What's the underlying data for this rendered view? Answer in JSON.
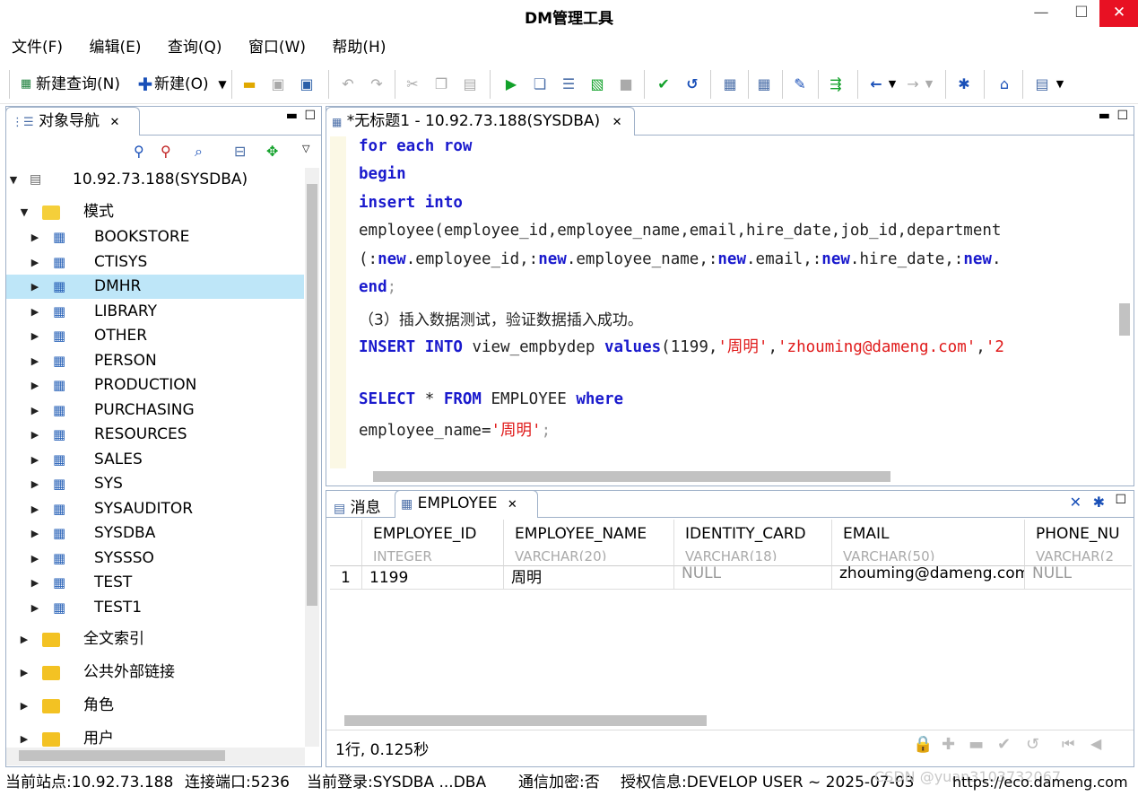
{
  "window": {
    "title": "DM管理工具",
    "minimize": "—",
    "maximize": "☐",
    "close": "✕"
  },
  "menu": [
    "文件(F)",
    "编辑(E)",
    "查询(Q)",
    "窗口(W)",
    "帮助(H)"
  ],
  "toolbar": {
    "new_query": "新建查询(N)",
    "new": "新建(O)"
  },
  "navigator": {
    "tab_label": "对象导航",
    "connection": "10.92.73.188(SYSDBA)",
    "schema_folder": "模式",
    "schemas": [
      "BOOKSTORE",
      "CTISYS",
      "DMHR",
      "LIBRARY",
      "OTHER",
      "PERSON",
      "PRODUCTION",
      "PURCHASING",
      "RESOURCES",
      "SALES",
      "SYS",
      "SYSAUDITOR",
      "SYSDBA",
      "SYSSSO",
      "TEST",
      "TEST1"
    ],
    "selected_schema": "DMHR",
    "folders": [
      "全文索引",
      "公共外部链接",
      "角色",
      "用户"
    ]
  },
  "editor": {
    "tab_label": "*无标题1 - 10.92.73.188(SYSDBA)",
    "lines": {
      "l1": "for each row",
      "l2": "begin",
      "l3": "insert into",
      "l4": "employee(employee_id,employee_name,email,hire_date,job_id,department",
      "l5a": "(:",
      "l5b": "new",
      "l5c": ".employee_id,:",
      "l5d": "new",
      "l5e": ".employee_name,:",
      "l5f": "new",
      "l5g": ".email,:",
      "l5h": "new",
      "l5i": ".hire_date,:",
      "l5j": "new",
      "l5k": ".",
      "l6": "end",
      "l6b": ";",
      "l7": "（3）插入数据测试，验证数据插入成功。",
      "l8a": "INSERT INTO",
      "l8b": " view_empbydep ",
      "l8c": "values",
      "l8d": "(1199,",
      "l8e": "'周明'",
      "l8f": ",",
      "l8g": "'zhouming@dameng.com'",
      "l8h": ",",
      "l8i": "'2",
      "l10a": "SELECT",
      "l10b": " * ",
      "l10c": "FROM",
      "l10d": " EMPLOYEE ",
      "l10e": "where",
      "l11a": "employee_name=",
      "l11b": "'周明'",
      "l11c": ";"
    }
  },
  "results": {
    "tab_messages": "消息",
    "tab_table": "EMPLOYEE",
    "columns": [
      {
        "name": "EMPLOYEE_ID",
        "type": "INTEGER"
      },
      {
        "name": "EMPLOYEE_NAME",
        "type": "VARCHAR(20)"
      },
      {
        "name": "IDENTITY_CARD",
        "type": "VARCHAR(18)"
      },
      {
        "name": "EMAIL",
        "type": "VARCHAR(50)"
      },
      {
        "name": "PHONE_NU",
        "type": "VARCHAR(2"
      }
    ],
    "rows": [
      {
        "num": "1",
        "c1": "1199",
        "c2": "周明",
        "c3": "NULL",
        "c4": "zhouming@dameng.com",
        "c5": "NULL"
      }
    ],
    "summary": "1行, 0.125秒"
  },
  "status": {
    "site": "当前站点:10.92.73.188",
    "port": "连接端口:5236",
    "login": "当前登录:SYSDBA ...DBA",
    "encrypt": "通信加密:否",
    "license": "授权信息:DEVELOP USER ~ 2025-07-03",
    "url": "https://eco.dameng.com",
    "watermark": "CSDN @yuan3103732067"
  },
  "colors": {
    "selection": "#bee6f8",
    "keyword": "#1a1acd",
    "string": "#e01a1a",
    "border": "#9eb0c8"
  }
}
